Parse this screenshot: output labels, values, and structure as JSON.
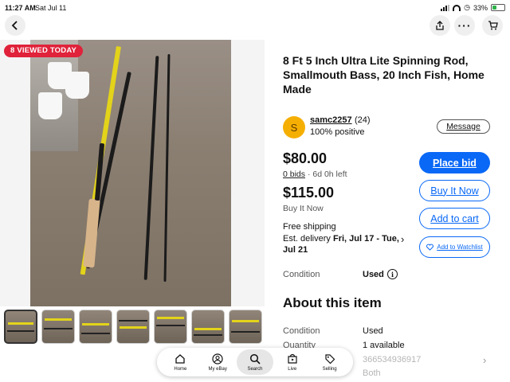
{
  "status_bar": {
    "time": "11:27 AM",
    "date": "Sat Jul 11",
    "battery_percent": "33%",
    "battery_level": 0.33
  },
  "nav": {
    "back_icon": "chevron-left-icon",
    "share_icon": "share-icon",
    "more_icon": "more-icon",
    "cart_icon": "cart-icon"
  },
  "badge": {
    "viewed": "8 VIEWED TODAY"
  },
  "listing": {
    "title": "8 Ft 5 Inch Ultra Lite Spinning Rod, Smallmouth Bass,  20 Inch Fish, Home Made"
  },
  "seller": {
    "initial": "S",
    "name": "samc2257",
    "feedback_count": "(24)",
    "positive": "100% positive",
    "message_label": "Message",
    "avatar_color": "#f5af02"
  },
  "pricing": {
    "bid_price": "$80.00",
    "bid_count": "0 bids",
    "time_left": " · 6d 0h left",
    "buy_now_price": "$115.00",
    "buy_now_label": "Buy It Now"
  },
  "shipping": {
    "free_shipping": "Free shipping",
    "delivery_prefix": "Est. delivery ",
    "delivery_dates": "Fri, Jul 17 - Tue, Jul 21"
  },
  "actions": {
    "place_bid": "Place bid",
    "buy_it_now": "Buy It Now",
    "add_to_cart": "Add to cart",
    "add_to_watchlist": "Add to Watchlist",
    "primary_color": "#0968f6"
  },
  "condition": {
    "label": "Condition",
    "value": "Used"
  },
  "about": {
    "heading": "About this item",
    "specs": [
      {
        "label": "Condition",
        "value": "Used"
      },
      {
        "label": "Quantity",
        "value": "1 available"
      },
      {
        "label": "",
        "value": "366534936917"
      },
      {
        "label": "",
        "value": "Both"
      }
    ]
  },
  "tabbar": {
    "tabs": [
      {
        "label": "Home",
        "icon": "home-icon"
      },
      {
        "label": "My eBay",
        "icon": "user-icon"
      },
      {
        "label": "Search",
        "icon": "search-icon",
        "active": true
      },
      {
        "label": "Live",
        "icon": "live-icon"
      },
      {
        "label": "Selling",
        "icon": "tag-icon"
      }
    ]
  },
  "thumbnails": {
    "count": 7,
    "selected_index": 0
  }
}
